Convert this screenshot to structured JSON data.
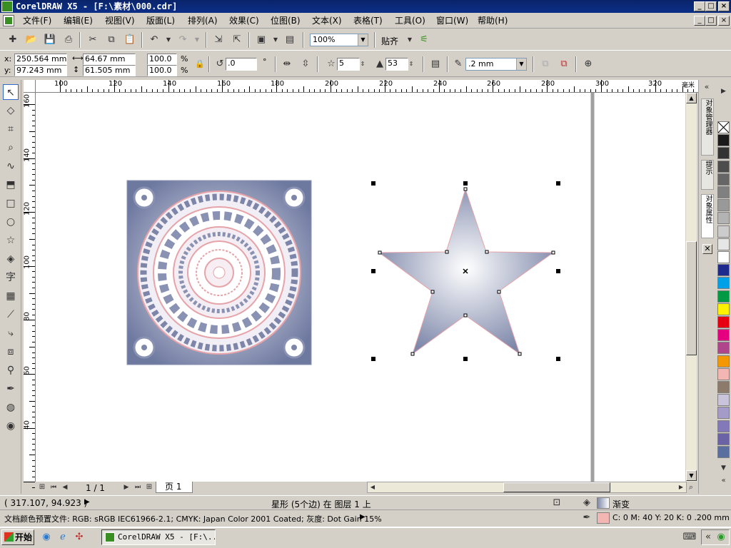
{
  "window": {
    "title": "CorelDRAW X5 - [F:\\素材\\000.cdr]",
    "btn_min": "_",
    "btn_max": "□",
    "btn_close": "×"
  },
  "menu": [
    "文件(F)",
    "编辑(E)",
    "视图(V)",
    "版面(L)",
    "排列(A)",
    "效果(C)",
    "位图(B)",
    "文本(X)",
    "表格(T)",
    "工具(O)",
    "窗口(W)",
    "帮助(H)"
  ],
  "toolbar1": {
    "zoom_value": "100%",
    "snap_label": "贴齐"
  },
  "property_bar": {
    "x_label": "x:",
    "x_value": "250.564 mm",
    "y_label": "y:",
    "y_value": "97.243 mm",
    "width_value": "64.67 mm",
    "height_value": "61.505 mm",
    "scale_x": "100.0",
    "scale_y": "100.0",
    "percent": "%",
    "rotation": ".0",
    "degree": "°",
    "points": "5",
    "sharpness": "53",
    "outline_width": ".2 mm"
  },
  "ruler": {
    "h_labels": [
      "100",
      "120",
      "140",
      "160",
      "180",
      "200",
      "220",
      "240",
      "260",
      "280",
      "300",
      "320"
    ],
    "h_unit": "毫米",
    "v_labels": [
      "160",
      "140",
      "120",
      "100",
      "80",
      "60",
      "40"
    ]
  },
  "page_nav": {
    "counter": "1 / 1",
    "tab": "页 1"
  },
  "docker_tabs": [
    "对象管理器",
    "提示",
    "对象属性"
  ],
  "palette": [
    "#ffffff",
    "#1a1a1a",
    "#333333",
    "#4d4d4d",
    "#666666",
    "#808080",
    "#999999",
    "#b3b3b3",
    "#cccccc",
    "#e6e6e6",
    "#ffffff",
    "#1e2a8c",
    "#00a0e9",
    "#009944",
    "#fff100",
    "#e60012",
    "#e4007f",
    "#b0458c",
    "#f39800",
    "#f4b6b2",
    "#8c7a6b",
    "#c9c4dc",
    "#a49bc8",
    "#8479b8",
    "#6b63a6",
    "#5a6fa0"
  ],
  "status": {
    "coords": "( 317.107, 94.923 )",
    "object_info": "星形 (5个边) 在 图层 1 上",
    "fill_label": "渐变",
    "color_profile": "文档颜色预置文件: RGB: sRGB IEC61966-2.1; CMYK: Japan Color 2001 Coated; 灰度: Dot Gain 15%",
    "outline_info": "C: 0 M: 40 Y: 20 K: 0  .200 mm"
  },
  "taskbar": {
    "start": "开始",
    "task": "CorelDRAW X5 - [F:\\..."
  }
}
